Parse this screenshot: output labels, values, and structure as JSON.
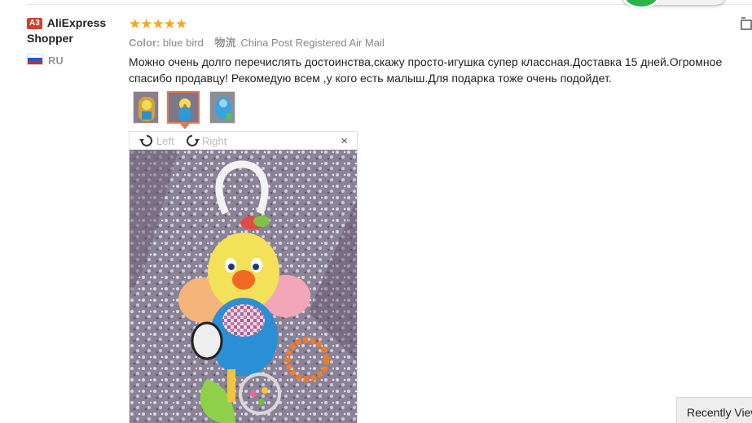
{
  "user": {
    "level_badge": "A3",
    "name": "AliExpress Shopper",
    "country": "RU"
  },
  "rating": {
    "stars": "★★★★★",
    "value": 5
  },
  "meta": {
    "color_label": "Color:",
    "color_value": "blue bird",
    "shipping_cn": "物流",
    "shipping_value": "China Post Registered Air Mail"
  },
  "review_text": "Можно очень долго перечислять достоинства,скажу просто-игушка супер классная.Доставка 15 дней.Огромное спасибо продавцу! Рекомедую всем ,у кого есть малыш.Для подарка тоже очень подойдет.",
  "thumbnails": {
    "count": 3,
    "selected_index": 1
  },
  "viewer": {
    "rotate_left": "Left",
    "rotate_right": "Right",
    "close": "×"
  },
  "recently_viewed": "Recently Viewed",
  "colors": {
    "accent": "#e07a4f",
    "star": "#f6a623",
    "badge": "#d73d2c",
    "green": "#2fb24a"
  }
}
